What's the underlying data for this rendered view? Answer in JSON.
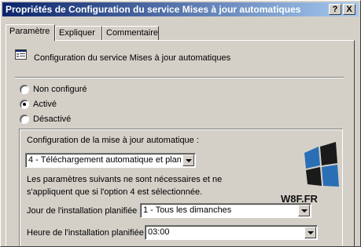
{
  "window": {
    "title": "Propriétés de Configuration du service Mises à jour automatiques",
    "help_button": "?",
    "close_button": "X"
  },
  "tabs": [
    {
      "label": "Paramètre",
      "active": true
    },
    {
      "label": "Expliquer",
      "active": false
    },
    {
      "label": "Commentaire",
      "active": false
    }
  ],
  "header": {
    "icon": "policy-setting-icon",
    "text": "Configuration du service Mises à jour automatiques"
  },
  "options": {
    "not_configured": "Non configuré",
    "enabled": "Activé",
    "disabled": "Désactivé",
    "selected": "enabled"
  },
  "settings": {
    "config_label": "Configuration de la mise à jour automatique :",
    "config_value": "4 - Téléchargement automatique et planifi",
    "note_line1": "Les paramètres suivants ne sont nécessaires et ne",
    "note_line2": "s'appliquent que si l'option 4 est sélectionnée.",
    "day_label": "Jour de l'installation planifiée :",
    "day_value": "1 - Tous les dimanches",
    "time_label": "Heure de l'installation planifiée :",
    "time_value": "03:00"
  },
  "watermark": {
    "text": "W8F.FR",
    "icon": "windows-logo-icon",
    "colors": {
      "blue": "#2a6fb5",
      "dark": "#1a1a1a"
    }
  }
}
